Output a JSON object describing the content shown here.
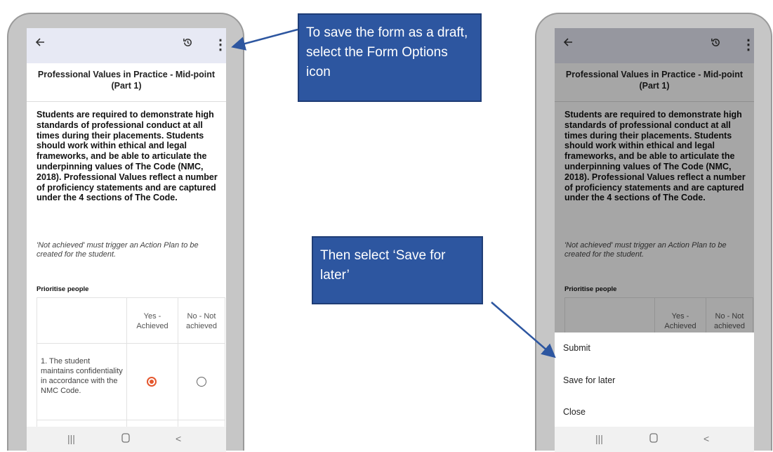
{
  "callouts": {
    "form_options_tip": "To save the form as a draft, select the Form Options icon",
    "save_for_later_tip": "Then select ‘Save for later’"
  },
  "screen": {
    "title": "Professional Values in Practice - Mid-point (Part 1)",
    "intro": "Students are required to demonstrate high standards of professional conduct at all times during their placements. Students should work within ethical and legal frameworks, and be able to articulate the underpinning values of The Code (NMC, 2018). Professional Values reflect a number of proficiency statements and are captured under the 4 sections of The Code.",
    "note": "'Not achieved' must trigger an Action Plan to be created for the student.",
    "section_title": "Prioritise people",
    "columns": [
      "Yes - Achieved",
      "No - Not achieved"
    ],
    "row1": {
      "criterion": "1. The student maintains confidentiality in accordance with the NMC Code.",
      "selected": "Yes - Achieved"
    }
  },
  "menu": {
    "items": [
      "Submit",
      "Save for later",
      "Close"
    ]
  },
  "icons": {
    "back": "back-arrow-icon",
    "history": "history-icon",
    "more": "more-vert-icon",
    "recents": "recents-icon",
    "home": "home-icon",
    "nav_back": "nav-back-icon"
  },
  "colors": {
    "callout": "#2d56a0",
    "radio_selected": "#e4572e",
    "appbar": "#e7e9f4"
  }
}
